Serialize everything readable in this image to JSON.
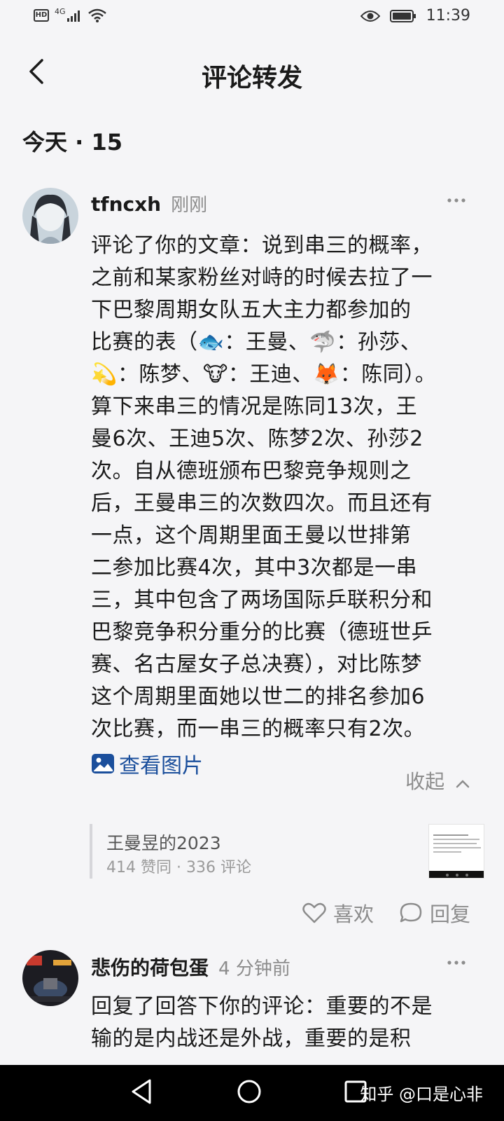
{
  "status_bar": {
    "left_badge": "HD",
    "network": "4G",
    "time": "11:39"
  },
  "header": {
    "title": "评论转发",
    "back_icon": "chevron-left-icon"
  },
  "date_heading": "今天 · 15",
  "comments": [
    {
      "user": "tfncxh",
      "time": "刚刚",
      "lines": [
        "评论了你的文章：说到串三的概率，",
        "之前和某家粉丝对峙的时候去拉了一",
        "下巴黎周期女队五大主力都参加的",
        "比赛的表（🐟：王曼、🦈：孙莎、",
        "💫：陈梦、🐮：王迪、🦊：陈同）。",
        "算下来串三的情况是陈同13次，王",
        "曼6次、王迪5次、陈梦2次、孙莎2",
        "次。自从德班颁布巴黎竞争规则之",
        "后，王曼串三的次数四次。而且还有",
        "一点，这个周期里面王曼以世排第",
        "二参加比赛4次，其中3次都是一串",
        "三，其中包含了两场国际乒联积分和",
        "巴黎竞争积分重分的比赛（德班世乒",
        "赛、名古屋女子总决赛），对比陈梦",
        "这个周期里面她以世二的排名参加6",
        "次比赛，而一串三的概率只有2次。"
      ],
      "view_image": "查看图片",
      "collapse": "收起",
      "quote": {
        "title": "王曼昱的2023",
        "meta": "414 赞同 · 336 评论"
      },
      "like_label": "喜欢",
      "reply_label": "回复"
    },
    {
      "user": "悲伤的荷包蛋",
      "time": "4 分钟前",
      "lines": [
        "回复了回答下你的评论：重要的不是",
        "输的是内战还是外战，重要的是积"
      ]
    }
  ],
  "nav": {
    "watermark": "知乎 @口是心非"
  }
}
